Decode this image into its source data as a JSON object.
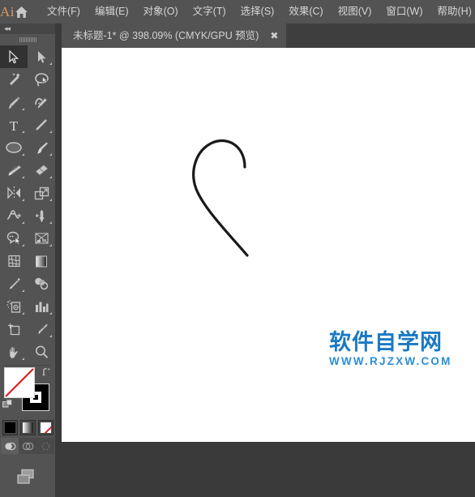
{
  "app": {
    "logo_text": "Ai",
    "home_icon": "home-icon"
  },
  "menubar": {
    "items": [
      {
        "label": "文件(F)",
        "name": "menu-file"
      },
      {
        "label": "编辑(E)",
        "name": "menu-edit"
      },
      {
        "label": "对象(O)",
        "name": "menu-object"
      },
      {
        "label": "文字(T)",
        "name": "menu-type"
      },
      {
        "label": "选择(S)",
        "name": "menu-select"
      },
      {
        "label": "效果(C)",
        "name": "menu-effect"
      },
      {
        "label": "视图(V)",
        "name": "menu-view"
      },
      {
        "label": "窗口(W)",
        "name": "menu-window"
      },
      {
        "label": "帮助(H)",
        "name": "menu-help"
      }
    ]
  },
  "tabstrip": {
    "tab_title": "未标题-1* @ 398.09% (CMYK/GPU 预览)",
    "close_label": "✖",
    "document_name": "未标题-1",
    "modified": true,
    "zoom_level": "398.09%",
    "color_mode": "CMYK",
    "preview_mode": "GPU 预览"
  },
  "toolbar": {
    "collapse_label": "◂◂",
    "tools": [
      {
        "name": "selection-tool",
        "label": "选择工具",
        "active": true,
        "flyout": false
      },
      {
        "name": "direct-selection-tool",
        "label": "直接选择工具",
        "active": false,
        "flyout": true
      },
      {
        "name": "magic-wand-tool",
        "label": "魔棒工具",
        "active": false,
        "flyout": false
      },
      {
        "name": "lasso-tool",
        "label": "套索工具",
        "active": false,
        "flyout": false
      },
      {
        "name": "pen-tool",
        "label": "钢笔工具",
        "active": false,
        "flyout": true
      },
      {
        "name": "curvature-tool",
        "label": "曲率工具",
        "active": false,
        "flyout": false
      },
      {
        "name": "type-tool",
        "label": "文字工具",
        "active": false,
        "flyout": true
      },
      {
        "name": "line-segment-tool",
        "label": "直线段工具",
        "active": false,
        "flyout": true
      },
      {
        "name": "ellipse-tool",
        "label": "椭圆工具",
        "active": false,
        "flyout": true
      },
      {
        "name": "paintbrush-tool",
        "label": "画笔工具",
        "active": false,
        "flyout": true
      },
      {
        "name": "shaper-pencil-tool",
        "label": "铅笔工具",
        "active": false,
        "flyout": true
      },
      {
        "name": "eraser-tool",
        "label": "橡皮擦工具",
        "active": false,
        "flyout": true
      },
      {
        "name": "rotate-reflect-tool",
        "label": "旋转工具",
        "active": false,
        "flyout": true
      },
      {
        "name": "scale-tool",
        "label": "比例缩放工具",
        "active": false,
        "flyout": true
      },
      {
        "name": "width-warp-tool",
        "label": "宽度工具",
        "active": false,
        "flyout": true
      },
      {
        "name": "free-transform-tool",
        "label": "自由变换工具",
        "active": false,
        "flyout": true
      },
      {
        "name": "shape-builder-tool",
        "label": "形状生成器",
        "active": false,
        "flyout": true
      },
      {
        "name": "perspective-grid-tool",
        "label": "透视网格工具",
        "active": false,
        "flyout": true
      },
      {
        "name": "mesh-tool",
        "label": "网格工具",
        "active": false,
        "flyout": false
      },
      {
        "name": "gradient-tool",
        "label": "渐变工具",
        "active": false,
        "flyout": false
      },
      {
        "name": "eyedropper-tool",
        "label": "吸管工具",
        "active": false,
        "flyout": true
      },
      {
        "name": "blend-tool",
        "label": "混合工具",
        "active": false,
        "flyout": false
      },
      {
        "name": "symbol-sprayer-tool",
        "label": "符号喷枪工具",
        "active": false,
        "flyout": true
      },
      {
        "name": "column-graph-tool",
        "label": "柱形图工具",
        "active": false,
        "flyout": true
      },
      {
        "name": "artboard-tool",
        "label": "画板工具",
        "active": false,
        "flyout": false
      },
      {
        "name": "slice-tool",
        "label": "切片工具",
        "active": false,
        "flyout": true
      },
      {
        "name": "hand-tool",
        "label": "抓手工具",
        "active": false,
        "flyout": true
      },
      {
        "name": "zoom-tool",
        "label": "缩放工具",
        "active": false,
        "flyout": false
      }
    ],
    "fill": {
      "label": "填色",
      "value": "无",
      "color": "#ffffff",
      "is_none": true
    },
    "stroke": {
      "label": "描边",
      "value": "黑色",
      "color": "#000000",
      "is_none": false
    },
    "color_modes": [
      {
        "name": "color-swatch-black",
        "label": "颜色",
        "color": "#000000"
      },
      {
        "name": "gradient-swatch",
        "label": "渐变",
        "color": "#808080"
      },
      {
        "name": "none-swatch",
        "label": "无",
        "color": "#ffffff"
      }
    ],
    "draw_modes": [
      {
        "name": "draw-normal-mode",
        "label": "正常绘图",
        "selected": true
      },
      {
        "name": "draw-behind-mode",
        "label": "背面绘图",
        "selected": false
      },
      {
        "name": "draw-inside-mode",
        "label": "内部绘图",
        "selected": false
      }
    ],
    "screen_mode": {
      "name": "screen-mode-button",
      "label": "更改屏幕模式"
    }
  },
  "canvas": {
    "background_color": "#ffffff",
    "artwork": {
      "name": "open-curve-path",
      "stroke_color": "#1a1a1a",
      "stroke_width": 3,
      "description": "手绘开放曲线路径（钩形/C形）"
    },
    "watermark": {
      "cn": "软件自学网",
      "en": "WWW.RJZXW.COM",
      "color": "#1b79c3"
    }
  }
}
